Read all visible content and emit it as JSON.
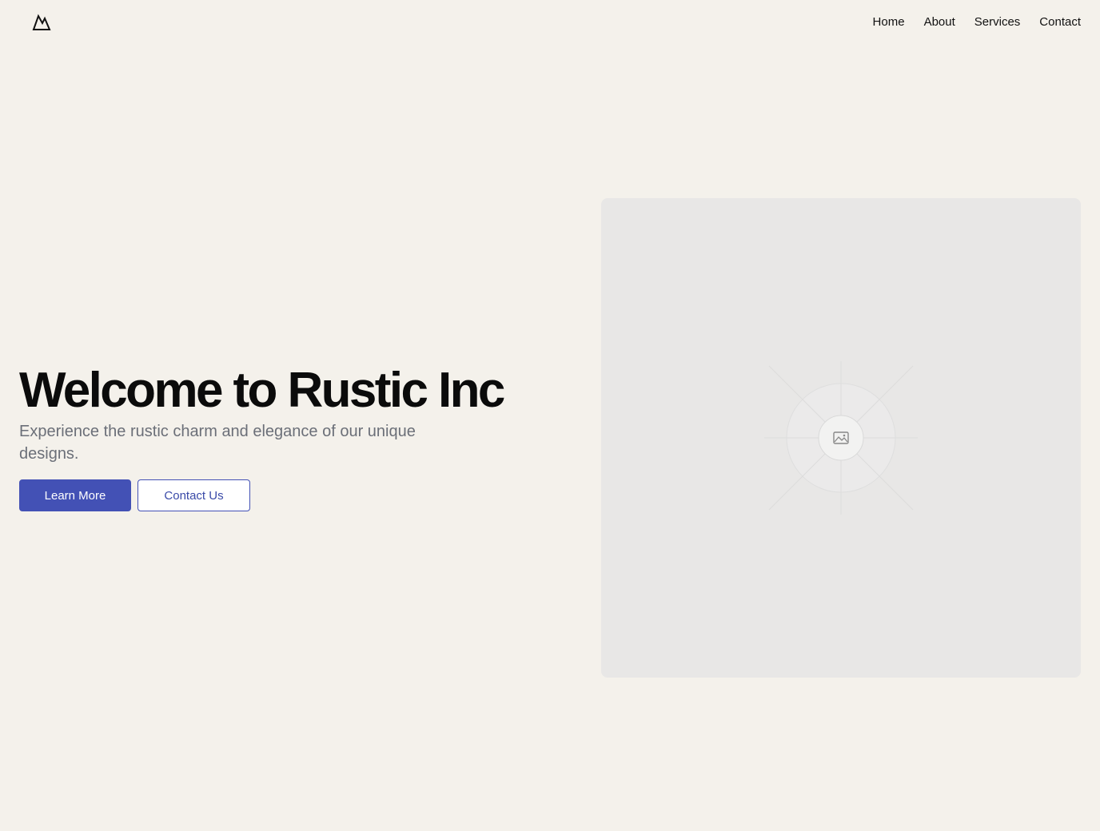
{
  "header": {
    "logo_icon": "mountain-icon",
    "nav": [
      {
        "label": "Home"
      },
      {
        "label": "About"
      },
      {
        "label": "Services"
      },
      {
        "label": "Contact"
      }
    ]
  },
  "hero": {
    "title": "Welcome to Rustic Inc",
    "subtitle": "Experience the rustic charm and elegance of our unique designs.",
    "primary_button": "Learn More",
    "secondary_button": "Contact Us",
    "image_icon": "image-placeholder-icon"
  },
  "colors": {
    "background": "#f4f1eb",
    "accent": "#4351b5",
    "placeholder": "#e8e7e6"
  }
}
